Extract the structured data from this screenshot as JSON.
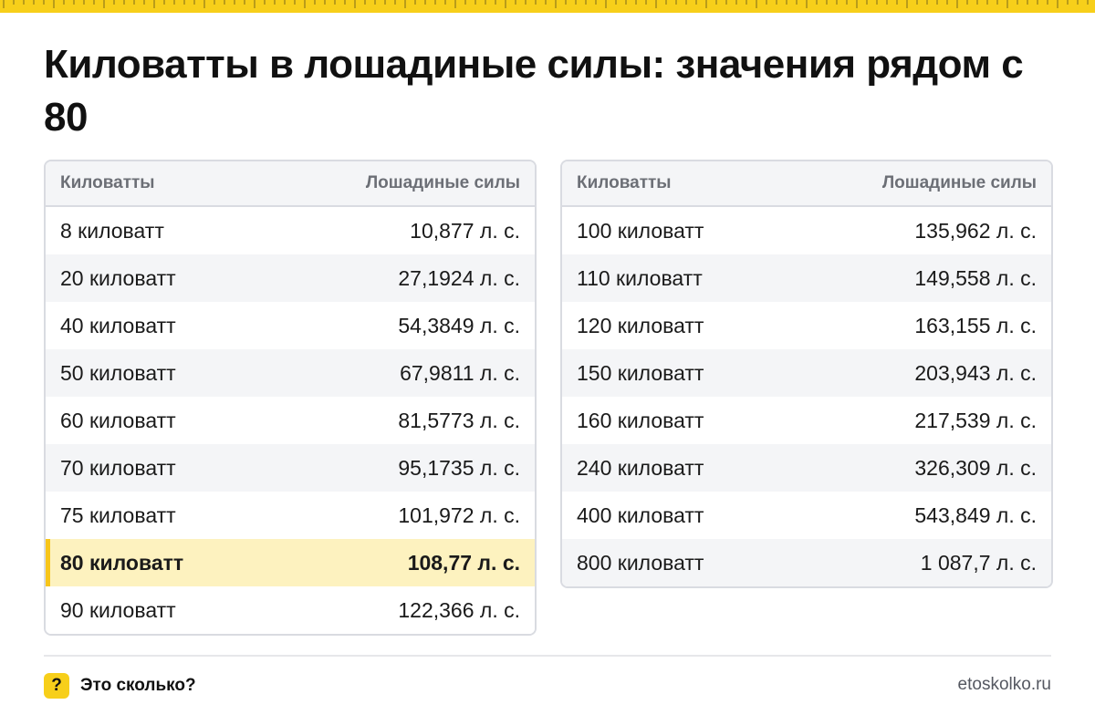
{
  "title": "Киловатты в лошадиные силы: значения рядом с 80",
  "colors": {
    "accent": "#f7cf1a",
    "highlight_bg": "#fdf2bf",
    "header_bg": "#f4f5f7",
    "border": "#d9dbe1"
  },
  "tables": [
    {
      "headers": [
        "Киловатты",
        "Лошадиные силы"
      ],
      "rows": [
        {
          "kw": "8 киловатт",
          "hp": "10,877 л. с."
        },
        {
          "kw": "20 киловатт",
          "hp": "27,1924 л. с."
        },
        {
          "kw": "40 киловатт",
          "hp": "54,3849 л. с."
        },
        {
          "kw": "50 киловатт",
          "hp": "67,9811 л. с."
        },
        {
          "kw": "60 киловатт",
          "hp": "81,5773 л. с."
        },
        {
          "kw": "70 киловатт",
          "hp": "95,1735 л. с."
        },
        {
          "kw": "75 киловатт",
          "hp": "101,972 л. с."
        },
        {
          "kw": "80 киловатт",
          "hp": "108,77 л. с.",
          "highlighted": true
        },
        {
          "kw": "90 киловатт",
          "hp": "122,366 л. с."
        }
      ]
    },
    {
      "headers": [
        "Киловатты",
        "Лошадиные силы"
      ],
      "rows": [
        {
          "kw": "100 киловатт",
          "hp": "135,962 л. с."
        },
        {
          "kw": "110 киловатт",
          "hp": "149,558 л. с."
        },
        {
          "kw": "120 киловатт",
          "hp": "163,155 л. с."
        },
        {
          "kw": "150 киловатт",
          "hp": "203,943 л. с."
        },
        {
          "kw": "160 киловатт",
          "hp": "217,539 л. с."
        },
        {
          "kw": "240 киловатт",
          "hp": "326,309 л. с."
        },
        {
          "kw": "400 киловатт",
          "hp": "543,849 л. с."
        },
        {
          "kw": "800 киловатт",
          "hp": "1 087,7 л. с."
        }
      ]
    }
  ],
  "footer": {
    "badge": "?",
    "brand": "Это сколько?",
    "site": "etoskolko.ru"
  }
}
